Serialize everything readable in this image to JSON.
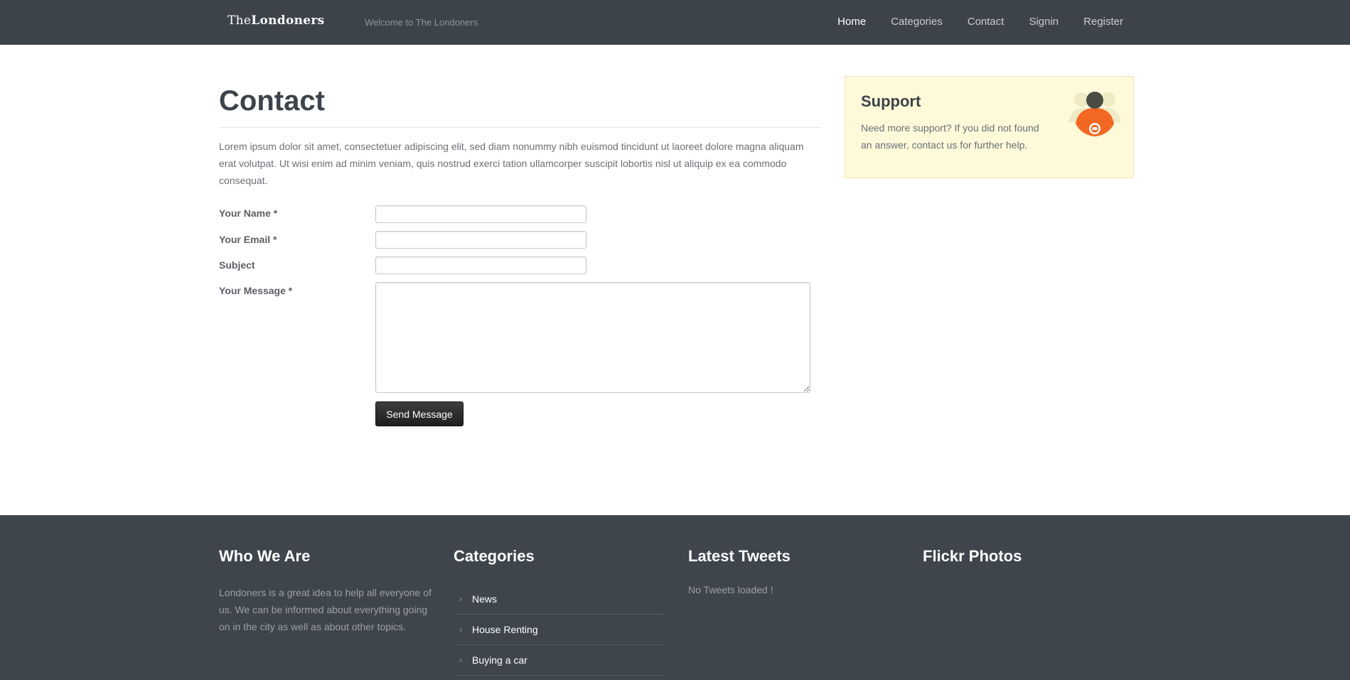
{
  "header": {
    "logo_prefix": "The",
    "logo_bold": "Londoners",
    "tagline": "Welcome to The Londoners",
    "nav": [
      "Home",
      "Categories",
      "Contact",
      "Signin",
      "Register"
    ]
  },
  "main": {
    "title": "Contact",
    "intro": "Lorem ipsum dolor sit amet, consectetuer adipiscing elit, sed diam nonummy nibh euismod tincidunt ut laoreet dolore magna aliquam erat volutpat. Ut wisi enim ad minim veniam, quis nostrud exerci tation ullamcorper suscipit lobortis nisl ut aliquip ex ea commodo consequat.",
    "form": {
      "name_label": "Your Name *",
      "email_label": "Your Email *",
      "subject_label": "Subject",
      "message_label": "Your Message *",
      "name_value": "",
      "email_value": "",
      "subject_value": "",
      "message_value": "",
      "submit_label": "Send Message"
    }
  },
  "support": {
    "title": "Support",
    "text": "Need more support? If you did not found an answer, contact us for further help.",
    "icon": "support-people-icon",
    "accent": "#f26722"
  },
  "footer": {
    "who_title": "Who We Are",
    "who_text": "Londoners is a great idea to help all everyone of us. We can be informed about everything going on in the city as well as about other topics.",
    "categories_title": "Categories",
    "categories": [
      "News",
      "House Renting",
      "Buying a car"
    ],
    "tweets_title": "Latest Tweets",
    "tweets_text": "No Tweets loaded !",
    "flickr_title": "Flickr Photos"
  },
  "colors": {
    "topbar": "#3d434b",
    "footer": "#3f454d",
    "support_bg": "#fdf9d9"
  }
}
